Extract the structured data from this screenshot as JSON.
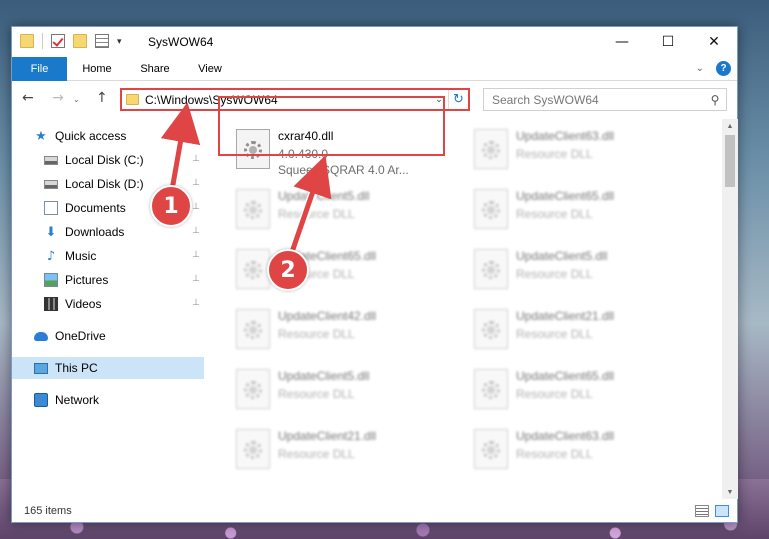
{
  "window": {
    "title": "SysWOW64",
    "minimize_glyph": "—",
    "maximize_glyph": "☐",
    "close_glyph": "✕"
  },
  "ribbon": {
    "tabs": [
      "File",
      "Home",
      "Share",
      "View"
    ],
    "expand_glyph": "⌄",
    "help_glyph": "?"
  },
  "nav": {
    "back_glyph": "←",
    "forward_glyph": "→",
    "recent_glyph": "⌄",
    "up_glyph": "↑",
    "address": "C:\\Windows\\SysWOW64",
    "address_drop_glyph": "⌄",
    "refresh_glyph": "↻",
    "search_placeholder": "Search SysWOW64",
    "search_glyph": "⚲"
  },
  "sidebar": {
    "items": [
      {
        "label": "Quick access",
        "icon": "star-icon",
        "pinned": false
      },
      {
        "label": "Local Disk (C:)",
        "icon": "drive-icon",
        "pinned": true
      },
      {
        "label": "Local Disk (D:)",
        "icon": "drive-icon",
        "pinned": true
      },
      {
        "label": "Documents",
        "icon": "documents-icon",
        "pinned": true
      },
      {
        "label": "Downloads",
        "icon": "download-icon",
        "pinned": true
      },
      {
        "label": "Music",
        "icon": "music-icon",
        "pinned": true
      },
      {
        "label": "Pictures",
        "icon": "pictures-icon",
        "pinned": true
      },
      {
        "label": "Videos",
        "icon": "videos-icon",
        "pinned": true
      },
      {
        "label": "OneDrive",
        "icon": "onedrive-icon",
        "pinned": false
      },
      {
        "label": "This PC",
        "icon": "computer-icon",
        "pinned": false,
        "selected": true
      },
      {
        "label": "Network",
        "icon": "network-icon",
        "pinned": false
      }
    ],
    "pin_glyph": "📌"
  },
  "files": [
    {
      "name": "cxrar40.dll",
      "line2": "4.0.430.0",
      "line3": "Squeez SQRAR 4.0 Ar...",
      "highlighted": true
    },
    {
      "name": "UpdateClient63.dll",
      "line2": "Resource DLL"
    },
    {
      "name": "UpdateClient5.dll",
      "line2": "Resource DLL"
    },
    {
      "name": "UpdateClient65.dll",
      "line2": "Resource DLL"
    },
    {
      "name": "UpdateClient65.dll",
      "line2": "Resource DLL"
    },
    {
      "name": "UpdateClient5.dll",
      "line2": "Resource DLL"
    },
    {
      "name": "UpdateClient42.dll",
      "line2": "Resource DLL"
    },
    {
      "name": "UpdateClient21.dll",
      "line2": "Resource DLL"
    },
    {
      "name": "UpdateClient5.dll",
      "line2": "Resource DLL"
    },
    {
      "name": "UpdateClient65.dll",
      "line2": "Resource DLL"
    },
    {
      "name": "UpdateClient21.dll",
      "line2": "Resource DLL"
    },
    {
      "name": "UpdateClient63.dll",
      "line2": "Resource DLL"
    }
  ],
  "status": {
    "item_count": "165 items"
  },
  "annotations": {
    "badge_1": "1",
    "badge_2": "2",
    "color": "#e04545"
  },
  "colors": {
    "accent": "#1979ca",
    "selection": "#cce4f7",
    "highlight": "#e04545"
  }
}
